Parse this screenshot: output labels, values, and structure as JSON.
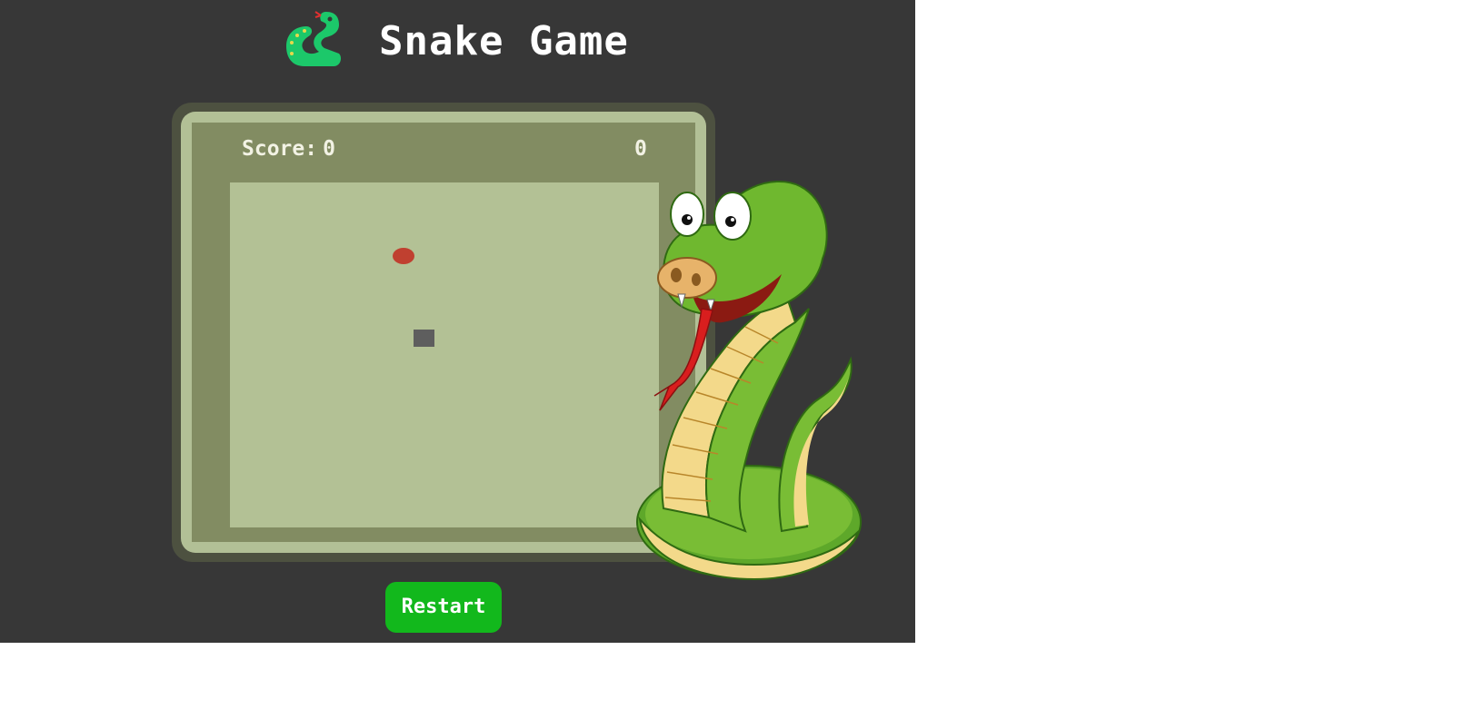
{
  "header": {
    "title": "Snake Game",
    "logo_icon": "snake-logo-icon"
  },
  "scoreboard": {
    "score_label": "Score:",
    "score_value": "0",
    "high_score_value": "0"
  },
  "board": {
    "food_icon": "apple-icon"
  },
  "controls": {
    "restart_label": "Restart"
  },
  "decoration": {
    "mascot_icon": "cartoon-snake-mascot"
  },
  "colors": {
    "background": "#373737",
    "console_rim": "#b2c096",
    "console_face": "#828c62",
    "board": "#b3c195",
    "food": "#c04030",
    "snake": "#5e5e5e",
    "restart_button": "#12b81c",
    "logo": "#1cc86a"
  }
}
